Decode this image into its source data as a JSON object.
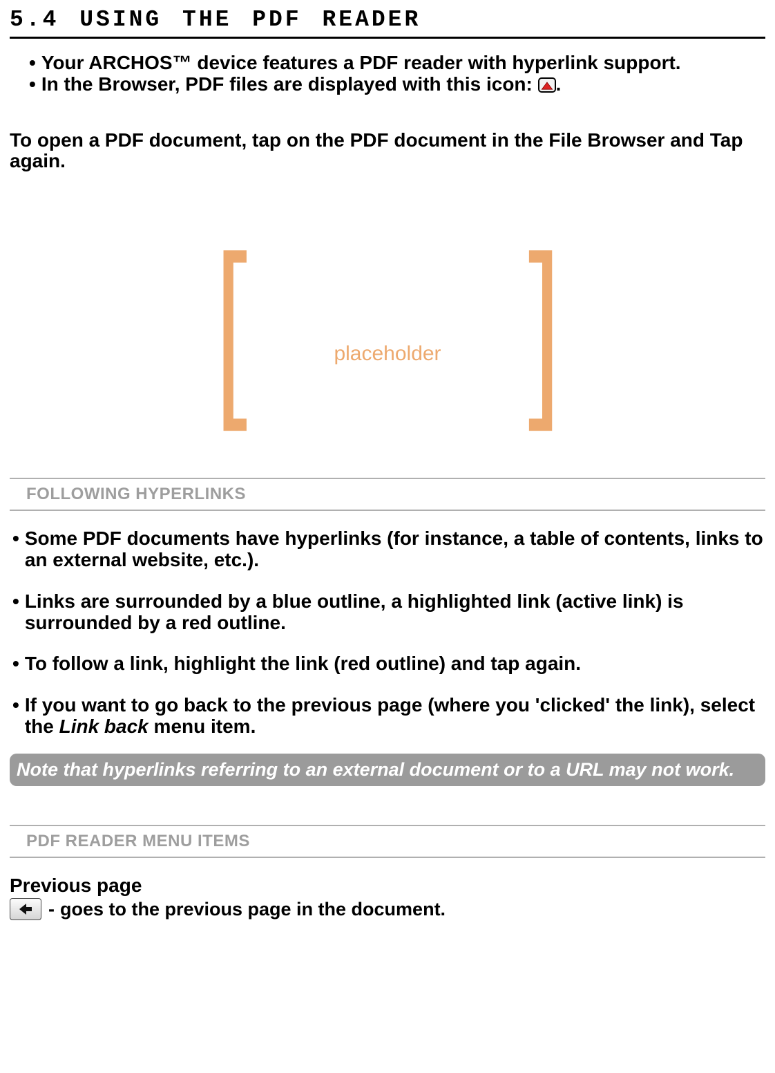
{
  "heading": "5.4  USING THE PDF READER",
  "intro": {
    "bullet1": "Your ARCHOS™ device features a PDF reader with hyperlink support.",
    "bullet2_before": "In the Browser, PDF files are displayed with this icon: ",
    "bullet2_after": "."
  },
  "open_paragraph": "To open a PDF document, tap on the PDF document in the File Browser and Tap again.",
  "placeholder_label": "placeholder",
  "sub_hyperlinks": "FOLLOWING HYPERLINKS",
  "hyperlinks": {
    "b1": "Some PDF documents have hyperlinks (for instance, a table of contents, links to an external website, etc.).",
    "b2": "Links are surrounded by a blue outline, a highlighted link (active link) is surrounded by a red outline.",
    "b3": "To follow a link, highlight the link (red outline) and tap again.",
    "b4_a": "If you want to go back to the previous page (where you 'clicked' the link), select the ",
    "b4_i": "Link back",
    "b4_b": " menu item."
  },
  "note": "Note that hyperlinks referring to an external document or to a URL may not work.",
  "sub_menu": "PDF READER MENU ITEMS",
  "prev": {
    "title": "Previous page",
    "desc": "goes to the previous page in the document."
  }
}
